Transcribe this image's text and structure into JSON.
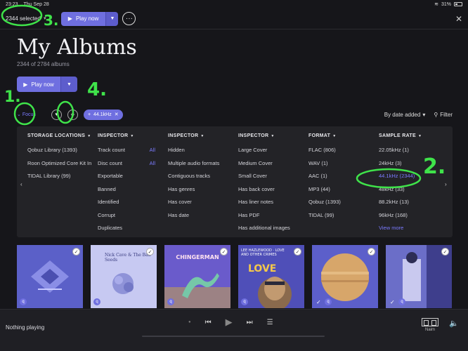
{
  "status_bar": {
    "time": "23:23",
    "date": "Thu Sep 28",
    "battery": "31%"
  },
  "topbar": {
    "selected_label": "2344 selected",
    "play_label": "Play now",
    "more_label": "···",
    "close_label": "✕"
  },
  "page": {
    "title": "My Albums",
    "subtitle": "2344 of 2784 albums",
    "play_label": "Play now"
  },
  "filters": {
    "focus_label": "Focus",
    "chip_label": "44.1kHz",
    "sort_label": "By date added",
    "filter_label": "Filter"
  },
  "focus_panel": {
    "columns": [
      {
        "header": "STORAGE LOCATIONS",
        "items": [
          "Qobuz Library (1393)",
          "Roon Optimized Core Kit In",
          "TIDAL Library (99)"
        ]
      },
      {
        "header": "INSPECTOR",
        "items": [
          "Track count",
          "Disc count",
          "Exportable",
          "Banned",
          "Identified",
          "Corrupt",
          "Duplicates"
        ],
        "side": [
          "All",
          "All"
        ]
      },
      {
        "header": "INSPECTOR",
        "items": [
          "Hidden",
          "Multiple audio formats",
          "Contiguous tracks",
          "Has genres",
          "Has cover",
          "Has date"
        ]
      },
      {
        "header": "INSPECTOR",
        "items": [
          "Large Cover",
          "Medium Cover",
          "Small Cover",
          "Has back cover",
          "Has liner notes",
          "Has PDF",
          "Has additional images"
        ]
      },
      {
        "header": "FORMAT",
        "items": [
          "FLAC (806)",
          "WAV (1)",
          "AAC (1)",
          "MP3 (44)",
          "Qobuz (1393)",
          "TIDAL (99)"
        ]
      },
      {
        "header": "SAMPLE RATE",
        "items": [
          "22.05kHz (1)",
          "24kHz (3)",
          "44.1kHz (2344)",
          "48kHz (33)",
          "88.2kHz (13)",
          "96kHz (168)",
          "View more"
        ]
      }
    ]
  },
  "albums": [
    {
      "name": "album-1",
      "text": ""
    },
    {
      "name": "album-2",
      "text": "Nick Cave & The Bad Seeds"
    },
    {
      "name": "album-3",
      "text": "CHINGERMAN"
    },
    {
      "name": "album-4",
      "text": "LEE HAZLEWOOD · LOVE AND OTHER CRIMES"
    },
    {
      "name": "album-5",
      "text": ""
    },
    {
      "name": "album-6",
      "text": ""
    }
  ],
  "player": {
    "now_playing": "Nothing playing",
    "zone_label": "Naim"
  },
  "annotations": [
    "3.",
    "1.",
    "4.",
    "2."
  ],
  "colors": {
    "accent": "#6f6fe0",
    "background": "#16161a",
    "panel": "#232327",
    "annotation": "#3fe34a"
  }
}
